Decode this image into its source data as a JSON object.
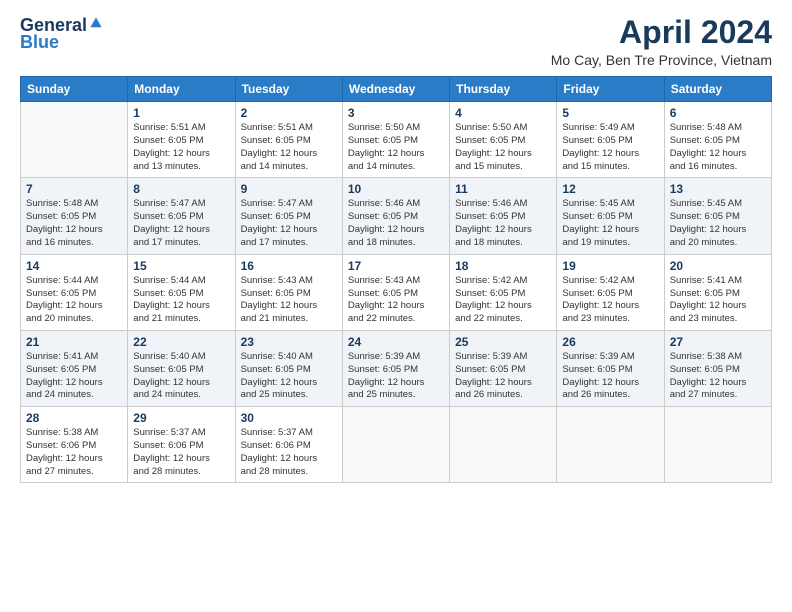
{
  "logo": {
    "general": "General",
    "blue": "Blue"
  },
  "title": "April 2024",
  "subtitle": "Mo Cay, Ben Tre Province, Vietnam",
  "weekdays": [
    "Sunday",
    "Monday",
    "Tuesday",
    "Wednesday",
    "Thursday",
    "Friday",
    "Saturday"
  ],
  "weeks": [
    [
      {
        "day": "",
        "info": ""
      },
      {
        "day": "1",
        "info": "Sunrise: 5:51 AM\nSunset: 6:05 PM\nDaylight: 12 hours\nand 13 minutes."
      },
      {
        "day": "2",
        "info": "Sunrise: 5:51 AM\nSunset: 6:05 PM\nDaylight: 12 hours\nand 14 minutes."
      },
      {
        "day": "3",
        "info": "Sunrise: 5:50 AM\nSunset: 6:05 PM\nDaylight: 12 hours\nand 14 minutes."
      },
      {
        "day": "4",
        "info": "Sunrise: 5:50 AM\nSunset: 6:05 PM\nDaylight: 12 hours\nand 15 minutes."
      },
      {
        "day": "5",
        "info": "Sunrise: 5:49 AM\nSunset: 6:05 PM\nDaylight: 12 hours\nand 15 minutes."
      },
      {
        "day": "6",
        "info": "Sunrise: 5:48 AM\nSunset: 6:05 PM\nDaylight: 12 hours\nand 16 minutes."
      }
    ],
    [
      {
        "day": "7",
        "info": "Sunrise: 5:48 AM\nSunset: 6:05 PM\nDaylight: 12 hours\nand 16 minutes."
      },
      {
        "day": "8",
        "info": "Sunrise: 5:47 AM\nSunset: 6:05 PM\nDaylight: 12 hours\nand 17 minutes."
      },
      {
        "day": "9",
        "info": "Sunrise: 5:47 AM\nSunset: 6:05 PM\nDaylight: 12 hours\nand 17 minutes."
      },
      {
        "day": "10",
        "info": "Sunrise: 5:46 AM\nSunset: 6:05 PM\nDaylight: 12 hours\nand 18 minutes."
      },
      {
        "day": "11",
        "info": "Sunrise: 5:46 AM\nSunset: 6:05 PM\nDaylight: 12 hours\nand 18 minutes."
      },
      {
        "day": "12",
        "info": "Sunrise: 5:45 AM\nSunset: 6:05 PM\nDaylight: 12 hours\nand 19 minutes."
      },
      {
        "day": "13",
        "info": "Sunrise: 5:45 AM\nSunset: 6:05 PM\nDaylight: 12 hours\nand 20 minutes."
      }
    ],
    [
      {
        "day": "14",
        "info": "Sunrise: 5:44 AM\nSunset: 6:05 PM\nDaylight: 12 hours\nand 20 minutes."
      },
      {
        "day": "15",
        "info": "Sunrise: 5:44 AM\nSunset: 6:05 PM\nDaylight: 12 hours\nand 21 minutes."
      },
      {
        "day": "16",
        "info": "Sunrise: 5:43 AM\nSunset: 6:05 PM\nDaylight: 12 hours\nand 21 minutes."
      },
      {
        "day": "17",
        "info": "Sunrise: 5:43 AM\nSunset: 6:05 PM\nDaylight: 12 hours\nand 22 minutes."
      },
      {
        "day": "18",
        "info": "Sunrise: 5:42 AM\nSunset: 6:05 PM\nDaylight: 12 hours\nand 22 minutes."
      },
      {
        "day": "19",
        "info": "Sunrise: 5:42 AM\nSunset: 6:05 PM\nDaylight: 12 hours\nand 23 minutes."
      },
      {
        "day": "20",
        "info": "Sunrise: 5:41 AM\nSunset: 6:05 PM\nDaylight: 12 hours\nand 23 minutes."
      }
    ],
    [
      {
        "day": "21",
        "info": "Sunrise: 5:41 AM\nSunset: 6:05 PM\nDaylight: 12 hours\nand 24 minutes."
      },
      {
        "day": "22",
        "info": "Sunrise: 5:40 AM\nSunset: 6:05 PM\nDaylight: 12 hours\nand 24 minutes."
      },
      {
        "day": "23",
        "info": "Sunrise: 5:40 AM\nSunset: 6:05 PM\nDaylight: 12 hours\nand 25 minutes."
      },
      {
        "day": "24",
        "info": "Sunrise: 5:39 AM\nSunset: 6:05 PM\nDaylight: 12 hours\nand 25 minutes."
      },
      {
        "day": "25",
        "info": "Sunrise: 5:39 AM\nSunset: 6:05 PM\nDaylight: 12 hours\nand 26 minutes."
      },
      {
        "day": "26",
        "info": "Sunrise: 5:39 AM\nSunset: 6:05 PM\nDaylight: 12 hours\nand 26 minutes."
      },
      {
        "day": "27",
        "info": "Sunrise: 5:38 AM\nSunset: 6:05 PM\nDaylight: 12 hours\nand 27 minutes."
      }
    ],
    [
      {
        "day": "28",
        "info": "Sunrise: 5:38 AM\nSunset: 6:06 PM\nDaylight: 12 hours\nand 27 minutes."
      },
      {
        "day": "29",
        "info": "Sunrise: 5:37 AM\nSunset: 6:06 PM\nDaylight: 12 hours\nand 28 minutes."
      },
      {
        "day": "30",
        "info": "Sunrise: 5:37 AM\nSunset: 6:06 PM\nDaylight: 12 hours\nand 28 minutes."
      },
      {
        "day": "",
        "info": ""
      },
      {
        "day": "",
        "info": ""
      },
      {
        "day": "",
        "info": ""
      },
      {
        "day": "",
        "info": ""
      }
    ]
  ]
}
